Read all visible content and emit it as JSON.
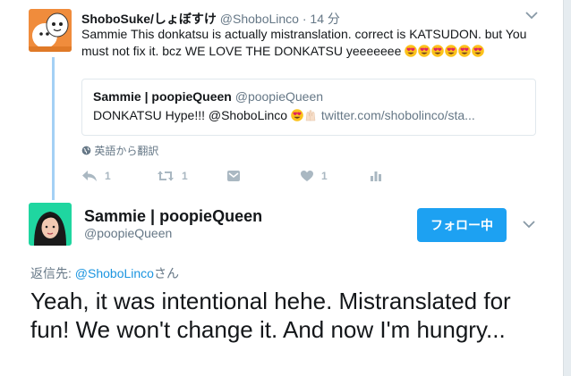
{
  "tweet": {
    "display_name": "ShoboSuke/しょぼすけ",
    "handle": "@ShoboLinco",
    "separator": "·",
    "timestamp": "14 分",
    "text": "Sammie This donkatsu is actually mistranslation. correct is KATSUDON. but You must not fix it. bcz WE LOVE THE DONKATSU yeeeeeee",
    "trailing_emoji_count": 6,
    "quote": {
      "display_name": "Sammie | poopieQueen",
      "handle": "@poopieQueen",
      "text_prefix": "DONKATSU Hype!!! @ShoboLinco",
      "link": "twitter.com/shobolinco/sta..."
    },
    "translate_label": "英語から翻訳",
    "actions": {
      "reply_count": "1",
      "retweet_count": "1",
      "like_count": "1"
    }
  },
  "reply": {
    "display_name": "Sammie | poopieQueen",
    "handle": "@poopieQueen",
    "follow_button_label": "フォロー中",
    "replying_to_prefix": "返信先: ",
    "replying_to_handle": "@ShoboLinco",
    "replying_to_suffix": "さん",
    "text": "Yeah, it was intentional hehe. Mistranslated for fun! We won't change it. And now I'm hungry..."
  },
  "colors": {
    "accent": "#1da1f2",
    "link": "#1b95e0",
    "muted": "#657786",
    "thread_line": "#a4d0f5"
  }
}
